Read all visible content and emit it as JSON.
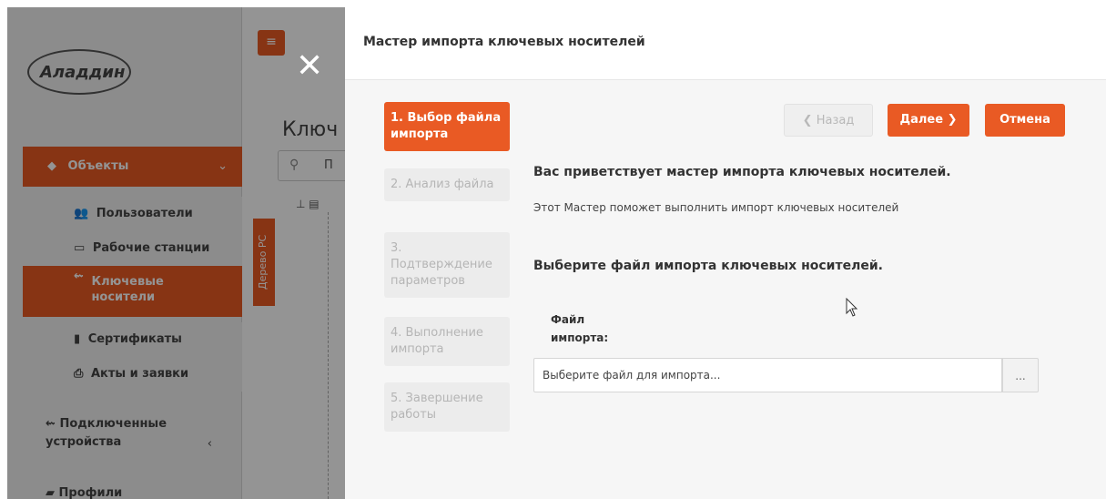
{
  "background": {
    "logo_text": "Аладдин",
    "page_title": "Ключ",
    "search_prefix": "П",
    "tree_tab_label": "Дерево РС",
    "sidebar": {
      "objects_label": "Объекты",
      "items": [
        {
          "label": "Пользователи",
          "icon": "users-icon"
        },
        {
          "label": "Рабочие станции",
          "icon": "monitor-icon"
        },
        {
          "label": "Ключевые носители",
          "icon": "usb-icon"
        },
        {
          "label": "Сертификаты",
          "icon": "file-icon"
        },
        {
          "label": "Акты и заявки",
          "icon": "printer-icon"
        }
      ],
      "connected_devices": "Подключенные устройства",
      "profiles": "Профили"
    }
  },
  "modal": {
    "title": "Мастер импорта ключевых носителей",
    "steps": [
      "1. Выбор файла импорта",
      "2. Анализ файла",
      "3. Подтверждение параметров",
      "4. Выполнение импорта",
      "5. Завершение работы"
    ],
    "active_step": 0,
    "buttons": {
      "back": "Назад",
      "next": "Далее",
      "cancel": "Отмена"
    },
    "welcome": "Вас приветствует мастер импорта ключевых носителей.",
    "description": "Этот Мастер поможет выполнить импорт ключевых носителей",
    "select_title": "Выберите файл импорта ключевых носителей.",
    "file_label": "Файл импорта:",
    "file_placeholder": "Выберите файл для импорта...",
    "browse_label": "..."
  },
  "colors": {
    "accent": "#e95a24",
    "overlay": "rgba(0,0,0,0.42)"
  }
}
